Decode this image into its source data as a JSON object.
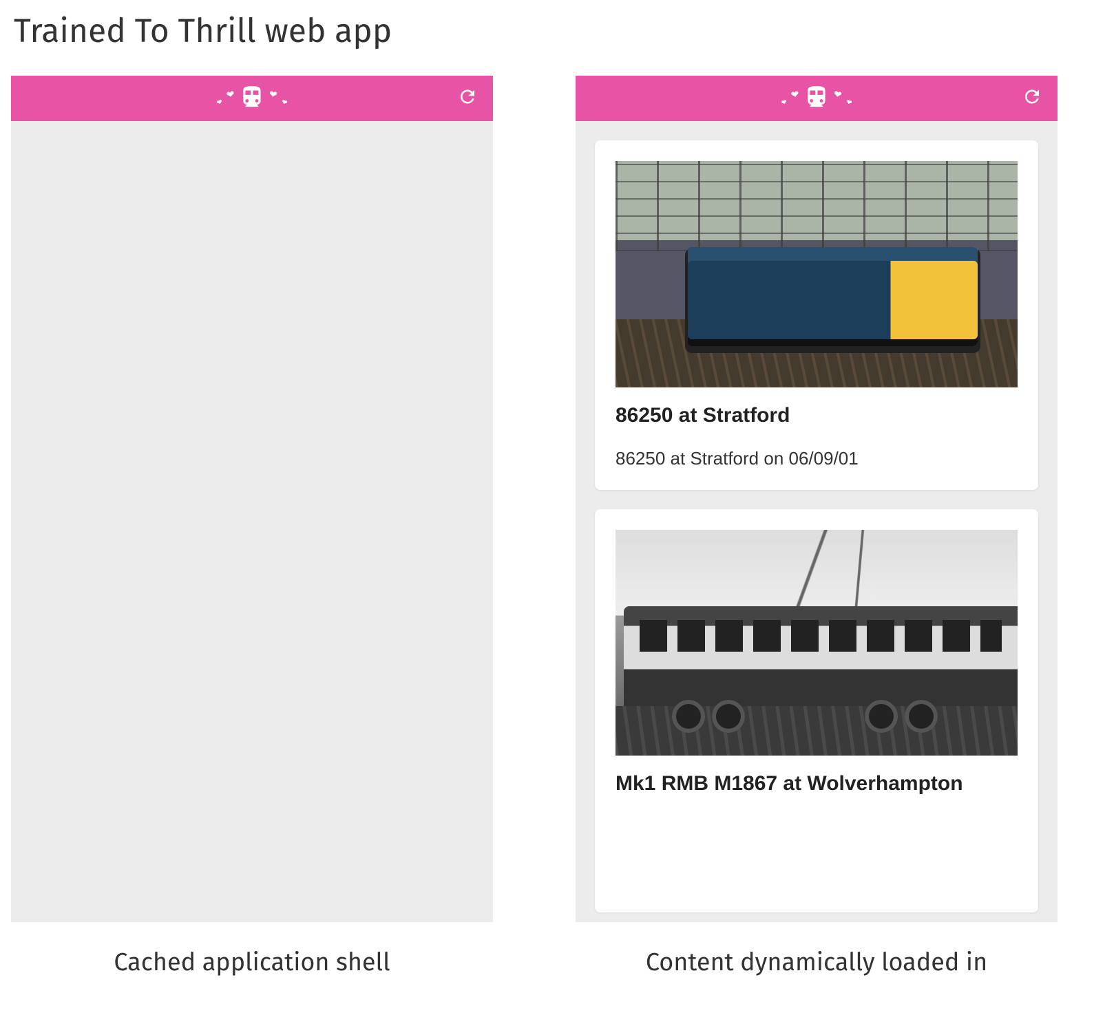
{
  "page_title": "Trained To Thrill web app",
  "topbar": {
    "logo_icon": "train-icon",
    "accent_color": "#e754a5",
    "refresh_label": "Refresh"
  },
  "panels": {
    "left": {
      "caption": "Cached application shell",
      "cards": []
    },
    "right": {
      "caption": "Content dynamically loaded in",
      "cards": [
        {
          "title": "86250 at Stratford",
          "description": "86250 at Stratford on 06/09/01",
          "image_alt": "Blue and yellow electric locomotive 86250 at Stratford"
        },
        {
          "title": "Mk1 RMB M1867 at Wolverhampton",
          "description": "",
          "image_alt": "Black and white photo of Mk1 RMB buffet coach M1867"
        }
      ]
    }
  }
}
